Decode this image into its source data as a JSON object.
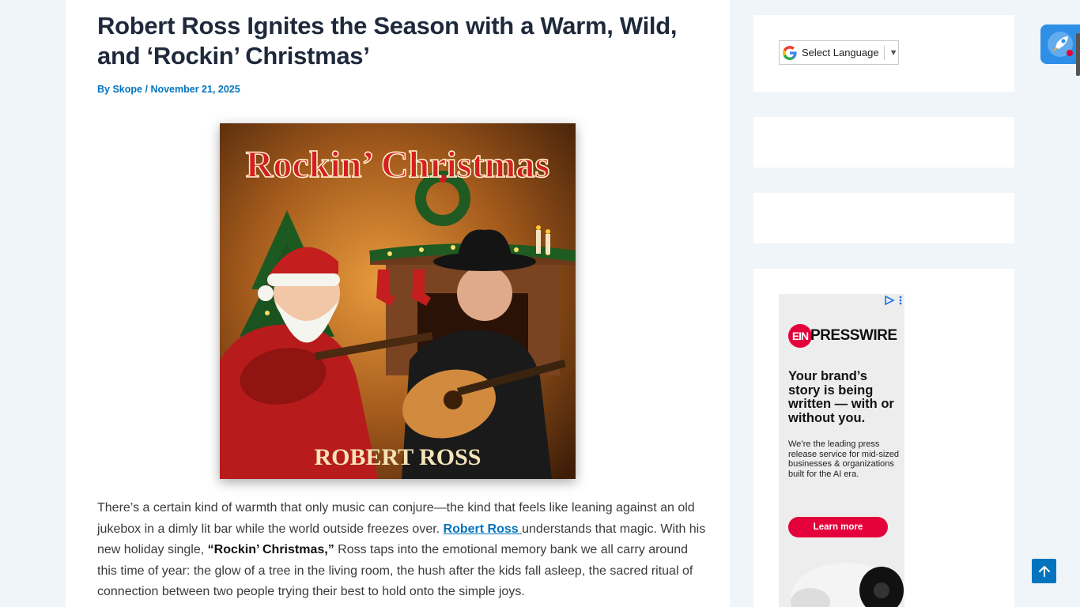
{
  "article": {
    "title": "Robert Ross Ignites the Season with a Warm, Wild, and ‘Rockin’ Christmas’",
    "meta": {
      "by_label": "By",
      "author": "Skope",
      "separator": "/",
      "date": "November 21, 2025"
    },
    "cover": {
      "title_text": "Rockin’ Christmas",
      "artist_text": "ROBERT ROSS"
    },
    "paragraph": {
      "part1": "There’s a certain kind of warmth that only music can conjure—the kind that feels like leaning against an old jukebox in a dimly lit bar while the world outside freezes over. ",
      "link": "Robert Ross ",
      "part2": "understands that magic. With his new holiday single, ",
      "strong": "“Rockin’ Christmas,”",
      "part3": " Ross taps into the emotional memory bank we all carry around this time of year: the glow of a tree in the living room, the hush after the kids fall asleep, the sacred ritual of connection between two people trying their best to hold onto the simple joys."
    }
  },
  "sidebar": {
    "language_select": {
      "label": "Select Language",
      "arrow": "▼"
    },
    "ad": {
      "logo_ein": "EIN",
      "logo_presswire": "PRESSWIRE",
      "headline": "Your brand’s story is being written — with or without you.",
      "subtext": "We’re the leading press release service for mid-sized businesses & organizations built for the AI era.",
      "cta": "Learn more",
      "choices_icon": "adchoices-icon",
      "menu_icon": "more-vert-icon"
    }
  },
  "floating": {
    "rocket_icon": "rocket-icon",
    "scroll_top_icon": "arrow-up-icon"
  },
  "colors": {
    "page_bg": "#f0f5fa",
    "link": "#0274be",
    "title": "#1e293b",
    "ad_accent": "#e4003a",
    "rocket_bg": "#2e8fe6"
  }
}
